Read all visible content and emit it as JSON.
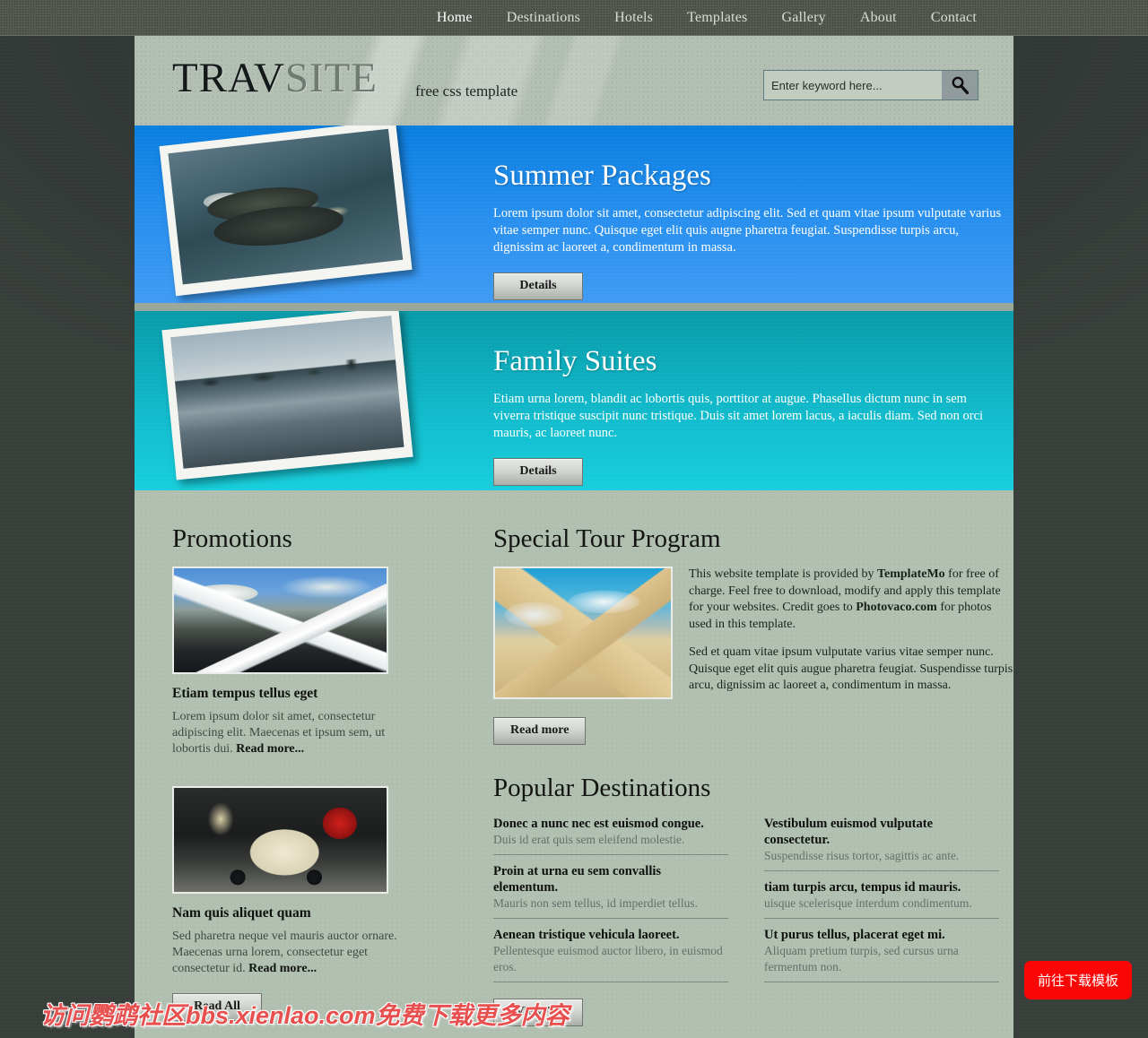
{
  "nav": {
    "items": [
      {
        "label": "Home",
        "active": true
      },
      {
        "label": "Destinations",
        "active": false
      },
      {
        "label": "Hotels",
        "active": false
      },
      {
        "label": "Templates",
        "active": false
      },
      {
        "label": "Gallery",
        "active": false
      },
      {
        "label": "About",
        "active": false
      },
      {
        "label": "Contact",
        "active": false
      }
    ]
  },
  "header": {
    "logo_primary": "TRAV",
    "logo_secondary": "SITE",
    "tagline": "free css template",
    "search": {
      "placeholder": "Enter keyword here...",
      "value": "",
      "icon": "search-icon"
    }
  },
  "banners": [
    {
      "title": "Summer Packages",
      "text": "Lorem ipsum dolor sit amet, consectetur adipiscing elit. Sed et quam vitae ipsum vulputate varius vitae semper nunc. Quisque eget elit quis augne pharetra feugiat. Suspendisse turpis arcu, dignissim ac laoreet a, condimentum in massa.",
      "button": "Details",
      "accent": "#2990ef",
      "photo": "aerial-island-photo"
    },
    {
      "title": "Family Suites",
      "text": "Etiam urna lorem, blandit ac lobortis quis, porttitor at augue. Phasellus dictum nunc in sem viverra tristique suscipit nunc tristique. Duis sit amet lorem lacus, a iaculis diam. Sed non orci mauris, ac laoreet nunc.",
      "button": "Details",
      "accent": "#11bccd",
      "photo": "waterfront-photo"
    }
  ],
  "promotions": {
    "heading": "Promotions",
    "items": [
      {
        "image": "snow-mountain-photo",
        "title": "Etiam tempus tellus eget",
        "desc": "Lorem ipsum dolor sit amet, consectetur adipiscing elit. Maecenas et ipsum sem, ut lobortis dui. ",
        "link": "Read more..."
      },
      {
        "image": "scooter-photo",
        "title": "Nam quis aliquet quam",
        "desc": "Sed pharetra neque vel mauris auctor ornare. Maecenas urna lorem, consectetur eget consectetur id. ",
        "link": "Read more..."
      }
    ],
    "button": "Read All"
  },
  "tour": {
    "heading": "Special Tour Program",
    "image": "pyramids-photo",
    "paragraph1_a": "This website template is provided by ",
    "paragraph1_b": "TemplateMo",
    "paragraph1_c": " for free of charge. Feel free to download, modify and apply this template for your websites. Credit goes to ",
    "paragraph1_d": "Photovaco.com",
    "paragraph1_e": " for photos used in this template.",
    "paragraph2": "Sed et quam vitae ipsum vulputate varius vitae semper nunc. Quisque eget elit quis augue pharetra feugiat. Suspendisse turpis arcu, dignissim ac laoreet a, condimentum in massa.",
    "button": "Read more"
  },
  "destinations": {
    "heading": "Popular Destinations",
    "left": [
      {
        "title": "Donec a nunc nec est euismod congue.",
        "desc": "Duis id erat quis sem eleifend molestie."
      },
      {
        "title": "Proin at urna eu sem convallis elementum.",
        "desc": "Mauris non sem tellus, id imperdiet tellus."
      },
      {
        "title": "Aenean tristique vehicula laoreet.",
        "desc": "Pellentesque euismod auctor libero, in euismod eros."
      }
    ],
    "right": [
      {
        "title": "Vestibulum euismod vulputate consectetur.",
        "desc": "Suspendisse risus tortor, sagittis ac ante."
      },
      {
        "title": "tiam turpis arcu, tempus id mauris.",
        "desc": "uisque scelerisque interdum condimentum."
      },
      {
        "title": "Ut purus tellus, placerat eget mi.",
        "desc": "Aliquam pretium turpis, sed cursus urna fermentum non."
      }
    ],
    "button": "View All"
  },
  "overlay": {
    "watermark": "访问鹦鹉社区bbs.xienlao.com免费下载更多内容",
    "download_button": "前往下载模板",
    "download_color": "#fb0606",
    "watermark_color": "#e8504f"
  }
}
